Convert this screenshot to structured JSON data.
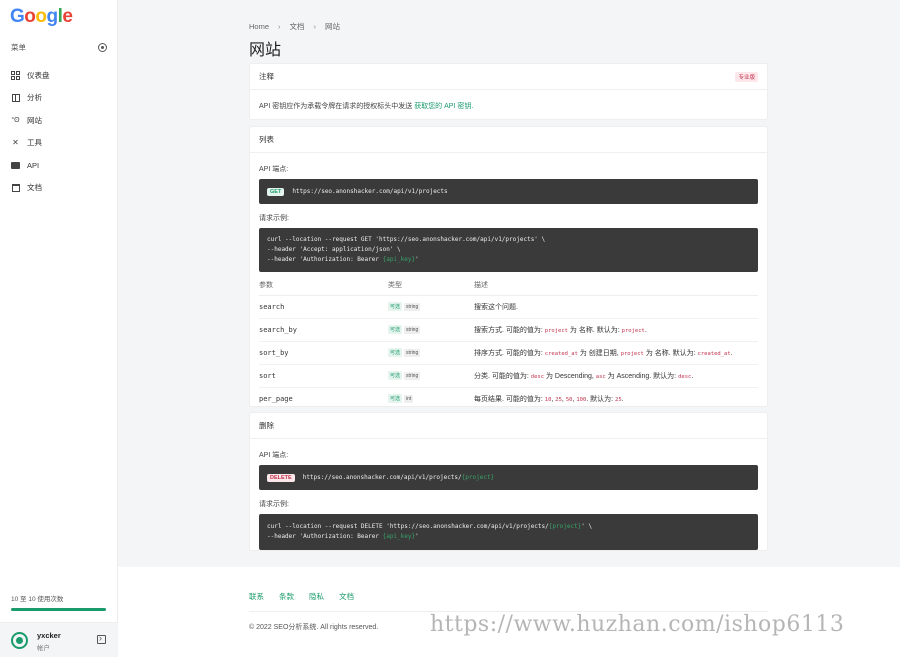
{
  "sidebar": {
    "logo": [
      "G",
      "o",
      "o",
      "g",
      "l",
      "e"
    ],
    "logo_colors": [
      "#4285F4",
      "#EA4335",
      "#FBBC05",
      "#4285F4",
      "#34A853",
      "#EA4335"
    ],
    "menu_label": "菜单",
    "items": [
      {
        "label": "仪表盘",
        "icon": "dashboard-icon"
      },
      {
        "label": "分析",
        "icon": "analytics-icon"
      },
      {
        "label": "网站",
        "icon": "website-icon"
      },
      {
        "label": "工具",
        "icon": "tools-icon"
      },
      {
        "label": "API",
        "icon": "api-icon"
      },
      {
        "label": "文档",
        "icon": "docs-icon"
      }
    ],
    "usage_text": "10 至 10 使用次数",
    "usage_fraction": 1.0,
    "account_name": "yxcker",
    "account_sub": "帐户"
  },
  "breadcrumb": {
    "home": "Home",
    "docs": "文档",
    "current": "网站"
  },
  "page_title": "网站",
  "note_card": {
    "title": "注释",
    "badge": "专业版",
    "text": "API 密钥应作为承载令牌在请求的授权标头中发送",
    "link": "获取您的 API 密钥."
  },
  "list_card": {
    "title": "列表",
    "endpoint_label": "API 端点:",
    "method": "GET",
    "url": "https://seo.anonshacker.com/api/v1/projects",
    "example_label": "请求示例:",
    "example_line1": "curl --location --request GET 'https://seo.anonshacker.com/api/v1/projects' \\",
    "example_line2": "--header 'Accept: application/json' \\",
    "example_line3_pre": "--header 'Authorization: Bearer ",
    "example_line3_key": "{api_key}",
    "example_line3_post": "'",
    "headers": {
      "param": "参数",
      "type": "类型",
      "desc": "描述"
    },
    "optional": "可选",
    "params": [
      {
        "name": "search",
        "type": "string",
        "desc": "搜索这个问题."
      },
      {
        "name": "search_by",
        "type": "string",
        "desc_pre": "搜索方式. 可能的值为: ",
        "c1": "project",
        "mid1": " 为 名称. 默认为: ",
        "c2": "project",
        "post": "."
      },
      {
        "name": "sort_by",
        "type": "string",
        "desc_pre": "排序方式. 可能的值为: ",
        "c1": "created_at",
        "mid1": " 为 创建日期, ",
        "c2": "project",
        "mid2": " 为 名称. 默认为: ",
        "c3": "created_at",
        "post": "."
      },
      {
        "name": "sort",
        "type": "string",
        "desc_pre": "分类. 可能的值为: ",
        "c1": "desc",
        "mid1": " 为 Descending, ",
        "c2": "asc",
        "mid2": " 为 Ascending. 默认为: ",
        "c3": "desc",
        "post": "."
      },
      {
        "name": "per_page",
        "type": "int",
        "desc_pre": "每页结果. 可能的值为: ",
        "c1": "10",
        "s1": ", ",
        "c2": "25",
        "s2": ", ",
        "c3": "50",
        "s3": ", ",
        "c4": "100",
        "mid": ". 默认为: ",
        "c5": "25",
        "post": "."
      }
    ]
  },
  "delete_card": {
    "title": "删除",
    "endpoint_label": "API 端点:",
    "method": "DELETE",
    "url_pre": "https://seo.anonshacker.com/api/v1/projects/",
    "url_param": "{project}",
    "example_label": "请求示例:",
    "line1_pre": "curl --location --request DELETE 'https://seo.anonshacker.com/api/v1/projects/",
    "line1_param": "{project}",
    "line1_post": "' \\",
    "line2_pre": "--header 'Authorization: Bearer ",
    "line2_key": "{api_key}",
    "line2_post": "'"
  },
  "footer": {
    "links": [
      "联系",
      "条款",
      "隐私",
      "文档"
    ],
    "copyright": "© 2022 SEO分析系统. All rights reserved.",
    "watermark": "https://www.huzhan.com/ishop6113"
  },
  "colors": {
    "accent": "#1a9b6c",
    "danger": "#c2334d",
    "code_bg": "#3a3a3a"
  }
}
